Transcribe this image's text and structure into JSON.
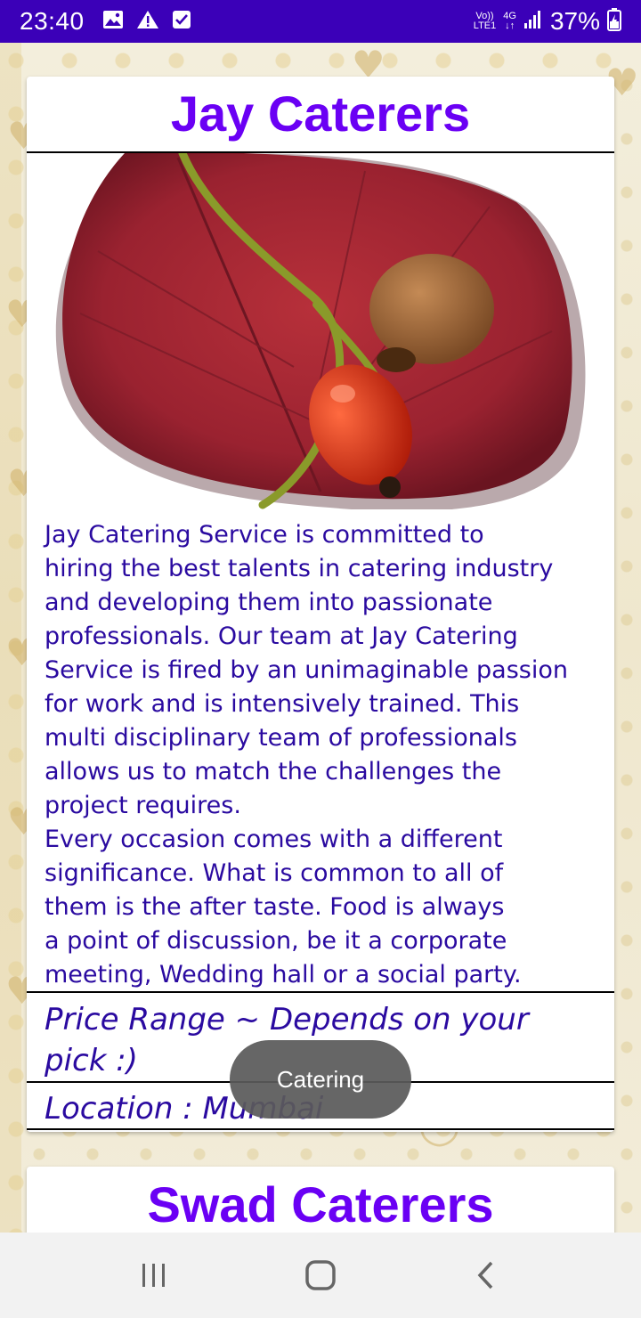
{
  "status_bar": {
    "time": "23:40",
    "notification_icons": [
      "image-icon",
      "warning-icon",
      "checkbox-icon"
    ],
    "network_label_1": "Vo))",
    "network_label_2": "LTE1",
    "network_type": "4G",
    "battery": "37%"
  },
  "caterers": [
    {
      "name": "Jay Caterers",
      "image_icon": "autumn-leaf-acorn-rosehip-photo",
      "description": "Jay Catering Service is committed to\nhiring the best talents in catering industry\nand developing them into passionate\nprofessionals. Our team at Jay Catering\nService is fired by an unimaginable passion\nfor work and is intensively trained. This\nmulti disciplinary team of professionals\nallows us to match the challenges the\nproject requires.\nEvery occasion comes with a different\nsignificance. What is common to all of\nthem is the after taste. Food is always\na point of discussion, be it a corporate\nmeeting, Wedding hall or a social party.",
      "price": "Price Range ~ Depends on your pick :)",
      "location": "Location : Mumbai"
    },
    {
      "name": "Swad Caterers"
    }
  ],
  "toast": "Catering",
  "colors": {
    "status_bar": "#3b00b8",
    "title": "#6a00f4",
    "body_text": "#2a0aa0"
  },
  "nav_icons": [
    "recent-apps-icon",
    "home-icon",
    "back-icon"
  ]
}
